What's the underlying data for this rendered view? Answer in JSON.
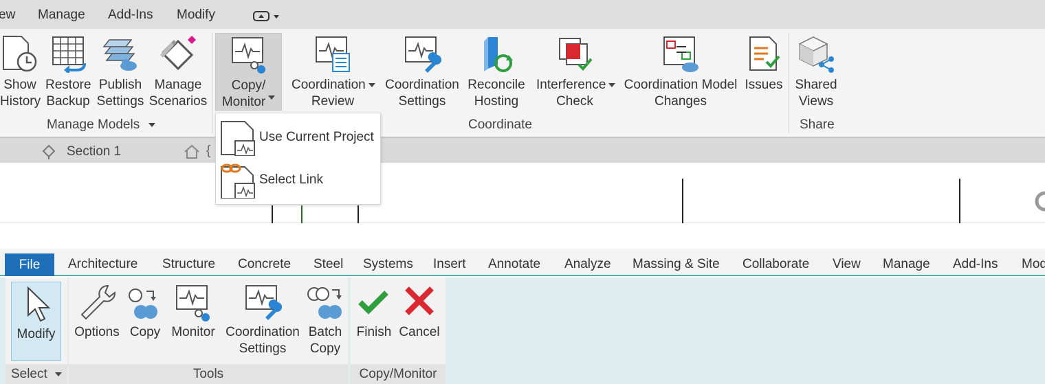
{
  "top_tabs": [
    "ew",
    "Manage",
    "Add-Ins",
    "Modify"
  ],
  "manage_models": {
    "buttons": [
      {
        "line1": "Show",
        "line2": "History",
        "icon": "history-icon"
      },
      {
        "line1": "Restore",
        "line2": "Backup",
        "icon": "restore-backup-icon"
      },
      {
        "line1": "Publish",
        "line2": "Settings",
        "icon": "publish-settings-icon"
      },
      {
        "line1": "Manage",
        "line2": "Scenarios",
        "icon": "manage-scenarios-icon"
      }
    ],
    "label": "Manage Models"
  },
  "coordinate": {
    "buttons": [
      {
        "line1": "Copy/",
        "line2": "Monitor",
        "icon": "copy-monitor-icon"
      },
      {
        "line1": "Coordination",
        "line2": "Review",
        "icon": "coordination-review-icon"
      },
      {
        "line1": "Coordination",
        "line2": "Settings",
        "icon": "coordination-settings-icon"
      },
      {
        "line1": "Reconcile",
        "line2": "Hosting",
        "icon": "reconcile-hosting-icon"
      },
      {
        "line1": "Interference",
        "line2": "Check",
        "icon": "interference-check-icon"
      },
      {
        "line1": "Coordination Model",
        "line2": "Changes",
        "icon": "coordination-model-changes-icon"
      },
      {
        "line1": "Issues",
        "line2": "",
        "icon": "issues-icon"
      }
    ],
    "label": "Coordinate"
  },
  "share": {
    "buttons": [
      {
        "line1": "Shared",
        "line2": "Views",
        "icon": "shared-views-icon"
      }
    ],
    "label": "Share"
  },
  "view_bar": {
    "section_label": "Section 1"
  },
  "dropdown": {
    "items": [
      {
        "label": "Use Current Project",
        "icon": "use-current-project-icon"
      },
      {
        "label": "Select Link",
        "icon": "select-link-icon"
      }
    ]
  },
  "bottom_tabs": [
    "File",
    "Architecture",
    "Structure",
    "Concrete",
    "Steel",
    "Systems",
    "Insert",
    "Annotate",
    "Analyze",
    "Massing & Site",
    "Collaborate",
    "View",
    "Manage",
    "Add-Ins",
    "Mod"
  ],
  "bottom_ribbon": {
    "select_group": {
      "button": "Modify",
      "label": "Select"
    },
    "tools_group": {
      "buttons": [
        {
          "line1": "Options",
          "line2": ""
        },
        {
          "line1": "Copy",
          "line2": ""
        },
        {
          "line1": "Monitor",
          "line2": ""
        },
        {
          "line1": "Coordination",
          "line2": "Settings"
        },
        {
          "line1": "Batch",
          "line2": "Copy"
        }
      ],
      "label": "Tools"
    },
    "copy_monitor_group": {
      "buttons": [
        {
          "line1": "Finish"
        },
        {
          "line1": "Cancel"
        }
      ],
      "label": "Copy/Monitor"
    }
  },
  "colors": {
    "file_tab": "#1e6fb8",
    "accent_teal": "#4db6ac",
    "finish_green": "#2e9e3e",
    "cancel_red": "#d9282f",
    "link_blue": "#2a86d3"
  }
}
